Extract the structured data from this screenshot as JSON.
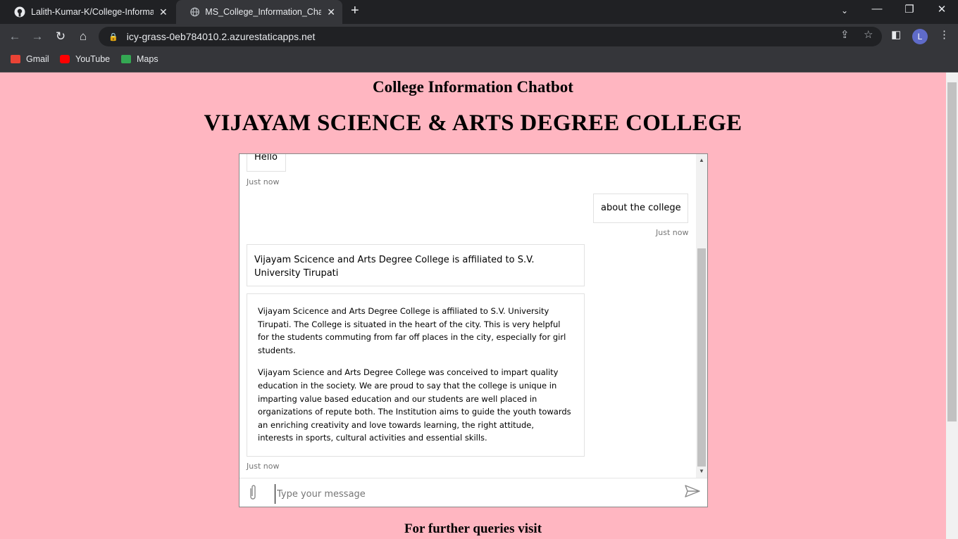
{
  "browser": {
    "tabs": [
      {
        "title": "Lalith-Kumar-K/College-Informat"
      },
      {
        "title": "MS_College_Information_Chatbot"
      }
    ],
    "url": "icy-grass-0eb784010.2.azurestaticapps.net",
    "profile_initial": "L",
    "bookmarks": [
      {
        "label": "Gmail",
        "color": "#ea4335"
      },
      {
        "label": "YouTube",
        "color": "#ff0000"
      },
      {
        "label": "Maps",
        "color": "#34a853"
      }
    ]
  },
  "page": {
    "subtitle": "College Information Chatbot",
    "title": "VIJAYAM SCIENCE & ARTS DEGREE COLLEGE",
    "footer_text": "For further queries visit",
    "background": "#ffb6c1"
  },
  "chat": {
    "messages": [
      {
        "from": "bot",
        "text": "Hello",
        "timestamp": "Just now"
      },
      {
        "from": "user",
        "text": "about the college",
        "timestamp": "Just now"
      },
      {
        "from": "bot",
        "text": "Vijayam Scicence and Arts Degree College is affiliated to S.V. University Tirupati"
      },
      {
        "from": "bot",
        "paragraphs": [
          "Vijayam Scicence and Arts Degree College is affiliated to S.V. University Tirupati. The College is situated in the heart of the city. This is very helpful for the students commuting from far off places in the city, especially for girl students.",
          "Vijayam Science and Arts Degree College was conceived to impart quality education in the society. We are proud to say that the college is unique in imparting value based education and our students are well placed in organizations of repute both. The Institution aims to guide the youth towards an enriching creativity and love towards learning, the right attitude, interests in sports, cultural activities and essential skills."
        ],
        "timestamp": "Just now"
      }
    ],
    "input_placeholder": "Type your message"
  }
}
